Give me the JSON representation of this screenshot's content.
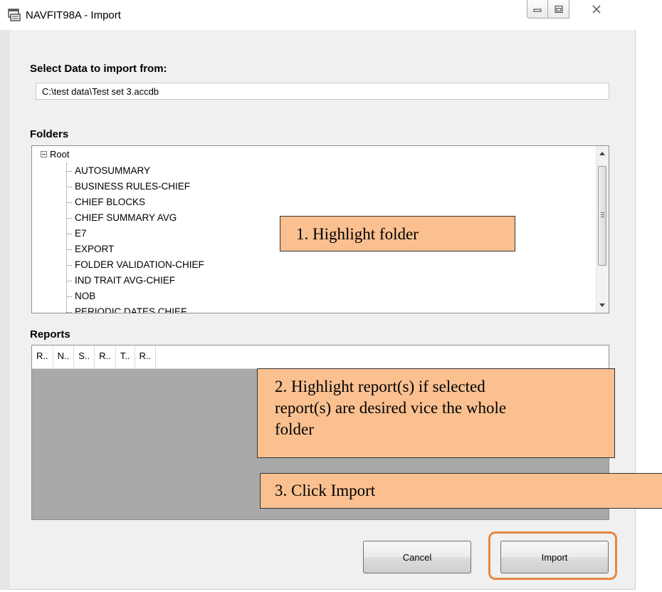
{
  "window": {
    "title": "NAVFIT98A - Import"
  },
  "source": {
    "label": "Select Data to import from:",
    "path_value": "C:\\test data\\Test set 3.accdb"
  },
  "folders": {
    "label": "Folders",
    "root": "Root",
    "items": [
      "AUTOSUMMARY",
      "BUSINESS RULES-CHIEF",
      "CHIEF BLOCKS",
      "CHIEF SUMMARY AVG",
      "E7",
      "EXPORT",
      "FOLDER VALIDATION-CHIEF",
      "IND TRAIT AVG-CHIEF",
      "NOB",
      "PERIODIC DATES CHIEF"
    ]
  },
  "reports": {
    "label": "Reports",
    "columns": [
      "R..",
      "N..",
      "S..",
      "R..",
      "T..",
      "R.."
    ]
  },
  "buttons": {
    "cancel": "Cancel",
    "import": "Import"
  },
  "callouts": {
    "step1": "1.  Highlight folder",
    "step2_line1": "2.  Highlight report(s) if selected",
    "step2_line2": "report(s) are desired vice the whole",
    "step2_line3": "folder",
    "step3": "3.  Click Import"
  },
  "colors": {
    "callout_fill": "#fac090",
    "highlight_ring": "#e8883f"
  },
  "icons": [
    "app-window-icon",
    "minimize-icon",
    "maximize-icon",
    "close-icon",
    "tree-collapse-icon",
    "scroll-up-icon",
    "scroll-down-icon"
  ]
}
